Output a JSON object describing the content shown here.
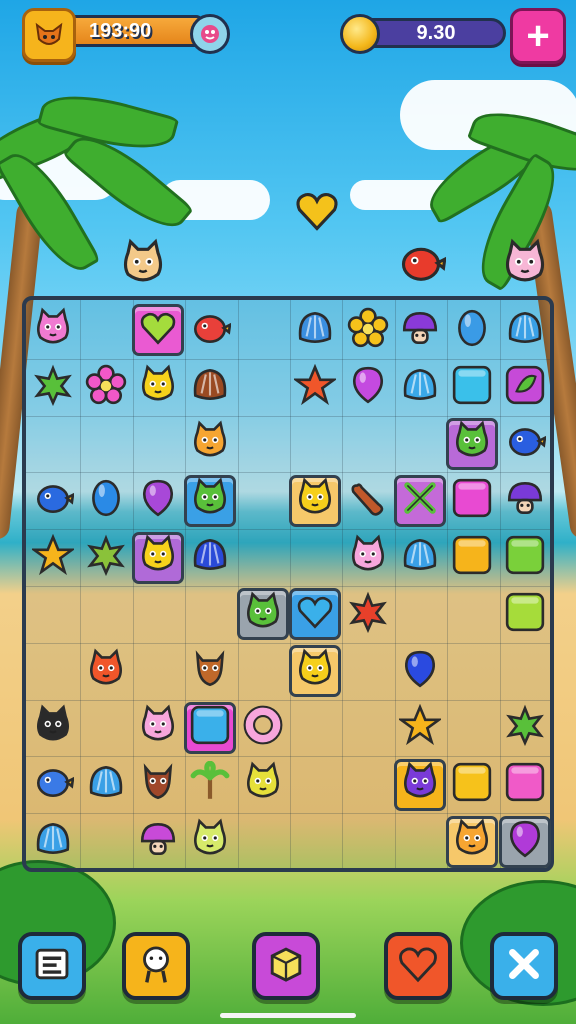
{
  "hud": {
    "score_text": "193:90",
    "coins_text": "9.30",
    "avatar_icon": "fox-icon",
    "badge_icon": "bird-face-icon",
    "coin_icon": "coin-icon",
    "add_icon": "plus-icon"
  },
  "floating": [
    {
      "icon": "heart-icon",
      "color": "#f4c21b"
    },
    {
      "icon": "pig-creature-icon",
      "color": "#f3c989"
    },
    {
      "icon": "bird-creature-icon",
      "color": "#e83b2c"
    },
    {
      "icon": "pig-creature-icon",
      "color": "#f7b6d5"
    }
  ],
  "board": {
    "pieces": [
      {
        "row": 0,
        "col": 0,
        "icon": "cat-creature-icon",
        "color": "#f07ad1"
      },
      {
        "row": 0,
        "col": 2,
        "icon": "heart-icon",
        "color": "#a4dc3c",
        "tile": "#ea5ad2"
      },
      {
        "row": 0,
        "col": 3,
        "icon": "fish-creature-icon",
        "color": "#e8403a"
      },
      {
        "row": 0,
        "col": 5,
        "icon": "shell-icon",
        "color": "#3b8fe0"
      },
      {
        "row": 0,
        "col": 6,
        "icon": "flower-icon",
        "color": "#f6c21b"
      },
      {
        "row": 0,
        "col": 7,
        "icon": "mushroom-creature-icon",
        "color": "#8a3ad8"
      },
      {
        "row": 0,
        "col": 8,
        "icon": "oval-gem-icon",
        "color": "#3a9be6"
      },
      {
        "row": 0,
        "col": 9,
        "icon": "shell-icon",
        "color": "#3aa0e6"
      },
      {
        "row": 1,
        "col": 0,
        "icon": "leaf-icon",
        "color": "#58c03a"
      },
      {
        "row": 1,
        "col": 1,
        "icon": "flower-icon",
        "color": "#f258c8"
      },
      {
        "row": 1,
        "col": 2,
        "icon": "cat-creature-icon",
        "color": "#f6d21b"
      },
      {
        "row": 1,
        "col": 3,
        "icon": "shell-icon",
        "color": "#9a4a22"
      },
      {
        "row": 1,
        "col": 5,
        "icon": "starfish-icon",
        "color": "#f0562a"
      },
      {
        "row": 1,
        "col": 6,
        "icon": "balloon-icon",
        "color": "#c44ae0"
      },
      {
        "row": 1,
        "col": 7,
        "icon": "shell-icon",
        "color": "#3aa8e8"
      },
      {
        "row": 1,
        "col": 8,
        "icon": "square-block-icon",
        "color": "#3ac0ea"
      },
      {
        "row": 1,
        "col": 9,
        "icon": "leaf-badge-icon",
        "color": "#c64ad8"
      },
      {
        "row": 2,
        "col": 3,
        "icon": "fox-creature-icon",
        "color": "#f6a531"
      },
      {
        "row": 2,
        "col": 8,
        "icon": "cat-creature-icon",
        "color": "#59c03a",
        "tile": "#b96ad8"
      },
      {
        "row": 2,
        "col": 9,
        "icon": "bird-creature-icon",
        "color": "#2a5ee0"
      },
      {
        "row": 3,
        "col": 0,
        "icon": "bird-creature-icon",
        "color": "#2a6ae0"
      },
      {
        "row": 3,
        "col": 1,
        "icon": "oval-gem-icon",
        "color": "#2a8ae6"
      },
      {
        "row": 3,
        "col": 2,
        "icon": "balloon-icon",
        "color": "#a848d8"
      },
      {
        "row": 3,
        "col": 3,
        "icon": "cat-creature-icon",
        "color": "#59c03a",
        "tile": "#3aa0e6"
      },
      {
        "row": 3,
        "col": 5,
        "icon": "duck-creature-icon",
        "color": "#f6cf1b",
        "tile": "#f6c86a"
      },
      {
        "row": 3,
        "col": 6,
        "icon": "bone-icon",
        "color": "#c0582a"
      },
      {
        "row": 3,
        "col": 7,
        "icon": "crossed-leaves-icon",
        "color": "#59c03a",
        "tile": "#c46ad8"
      },
      {
        "row": 3,
        "col": 8,
        "icon": "square-block-icon",
        "color": "#e84ad2"
      },
      {
        "row": 3,
        "col": 9,
        "icon": "mushroom-creature-icon",
        "color": "#7a3ad8"
      },
      {
        "row": 4,
        "col": 0,
        "icon": "starfish-icon",
        "color": "#f6b41b"
      },
      {
        "row": 4,
        "col": 1,
        "icon": "leaf-icon",
        "color": "#8ac23a"
      },
      {
        "row": 4,
        "col": 2,
        "icon": "duck-creature-icon",
        "color": "#f6d21b",
        "tile": "#b06ad8"
      },
      {
        "row": 4,
        "col": 3,
        "icon": "shell-icon",
        "color": "#2a4ad8"
      },
      {
        "row": 4,
        "col": 6,
        "icon": "cat-creature-icon",
        "color": "#f7a6dc"
      },
      {
        "row": 4,
        "col": 7,
        "icon": "shell-icon",
        "color": "#3aa0e6"
      },
      {
        "row": 4,
        "col": 8,
        "icon": "square-block-icon",
        "color": "#f6b41b"
      },
      {
        "row": 4,
        "col": 9,
        "icon": "square-block-icon",
        "color": "#7ad03a"
      },
      {
        "row": 5,
        "col": 4,
        "icon": "cat-creature-icon",
        "color": "#59c03a",
        "tile": "#9aa4ad"
      },
      {
        "row": 5,
        "col": 5,
        "icon": "heart-icon",
        "color": "#3ab0ea",
        "tile": "#3aa0e6"
      },
      {
        "row": 5,
        "col": 6,
        "icon": "leaf-icon",
        "color": "#e8402a"
      },
      {
        "row": 5,
        "col": 9,
        "icon": "square-block-icon",
        "color": "#a6dc3a"
      },
      {
        "row": 6,
        "col": 1,
        "icon": "bear-creature-icon",
        "color": "#f0562a"
      },
      {
        "row": 6,
        "col": 3,
        "icon": "deer-creature-icon",
        "color": "#c0682a"
      },
      {
        "row": 6,
        "col": 5,
        "icon": "duck-creature-icon",
        "color": "#f6cf1b",
        "tile": "#f6c86a"
      },
      {
        "row": 6,
        "col": 7,
        "icon": "balloon-icon",
        "color": "#2a4ae0"
      },
      {
        "row": 7,
        "col": 0,
        "icon": "cat-creature-icon",
        "color": "#2a2a2a"
      },
      {
        "row": 7,
        "col": 2,
        "icon": "cat-creature-icon",
        "color": "#f7a6dc"
      },
      {
        "row": 7,
        "col": 3,
        "icon": "square-block-icon",
        "color": "#3ab0ea",
        "tile": "#e84ad2"
      },
      {
        "row": 7,
        "col": 4,
        "icon": "ring-icon",
        "color": "#f7a6dc"
      },
      {
        "row": 7,
        "col": 7,
        "icon": "starfish-icon",
        "color": "#f6b41b"
      },
      {
        "row": 7,
        "col": 9,
        "icon": "leaf-icon",
        "color": "#59c03a"
      },
      {
        "row": 8,
        "col": 0,
        "icon": "bird-creature-icon",
        "color": "#3a7ae6"
      },
      {
        "row": 8,
        "col": 1,
        "icon": "shell-icon",
        "color": "#3aa0e6"
      },
      {
        "row": 8,
        "col": 2,
        "icon": "deer-creature-icon",
        "color": "#a0482a"
      },
      {
        "row": 8,
        "col": 3,
        "icon": "palm-icon",
        "color": "#59c03a"
      },
      {
        "row": 8,
        "col": 4,
        "icon": "cat-creature-icon",
        "color": "#e6e03a"
      },
      {
        "row": 8,
        "col": 7,
        "icon": "cat-creature-icon",
        "color": "#7a3ad8",
        "tile": "#f6b41b"
      },
      {
        "row": 8,
        "col": 8,
        "icon": "square-block-icon",
        "color": "#f6c21b"
      },
      {
        "row": 8,
        "col": 9,
        "icon": "square-block-icon",
        "color": "#f05ac8"
      },
      {
        "row": 9,
        "col": 0,
        "icon": "shell-icon",
        "color": "#3aa0e6"
      },
      {
        "row": 9,
        "col": 2,
        "icon": "mushroom-creature-icon",
        "color": "#c84ad8"
      },
      {
        "row": 9,
        "col": 3,
        "icon": "cat-creature-icon",
        "color": "#d6ea6a"
      },
      {
        "row": 9,
        "col": 8,
        "icon": "fox-creature-icon",
        "color": "#f6a531",
        "tile": "#f6c86a"
      },
      {
        "row": 9,
        "col": 9,
        "icon": "balloon-icon",
        "color": "#b03ad8",
        "tile": "#9aa4ad"
      }
    ]
  },
  "toolbar": [
    {
      "icon": "map-icon",
      "color": "#3ab0ea"
    },
    {
      "icon": "hand-icon",
      "color": "#f6b41b"
    },
    {
      "icon": "cube-icon",
      "color": "#c84ad8"
    },
    {
      "icon": "heart-icon",
      "color": "#f0562a"
    },
    {
      "icon": "close-icon",
      "color": "#3ab0ea"
    }
  ]
}
